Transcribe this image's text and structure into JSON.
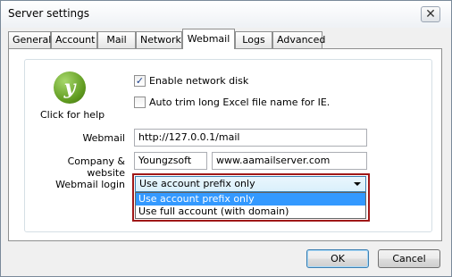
{
  "window": {
    "title": "Server settings",
    "close_glyph": "✕"
  },
  "tabs": [
    {
      "label": "General",
      "active": false
    },
    {
      "label": "Account",
      "active": false
    },
    {
      "label": "Mail",
      "active": false
    },
    {
      "label": "Network",
      "active": false
    },
    {
      "label": "Webmail",
      "active": true
    },
    {
      "label": "Logs",
      "active": false
    },
    {
      "label": "Advanced",
      "active": false
    }
  ],
  "help": {
    "icon": "youngzsoft-logo-icon",
    "glyph": "y",
    "label": "Click for help"
  },
  "options": {
    "enable_network_disk": {
      "label": "Enable network disk",
      "checked": true
    },
    "auto_trim": {
      "label": "Auto trim long Excel file name for IE.",
      "checked": false
    }
  },
  "fields": {
    "webmail": {
      "label": "Webmail",
      "value": "http://127.0.0.1/mail"
    },
    "company_website": {
      "label": "Company & website",
      "company": "Youngzsoft",
      "website": "www.aamailserver.com"
    },
    "webmail_login": {
      "label": "Webmail login",
      "selected": "Use account prefix only",
      "dropdown_options": [
        "Use account prefix only",
        "Use full account (with domain)"
      ]
    }
  },
  "buttons": {
    "ok": "OK",
    "cancel": "Cancel"
  },
  "colors": {
    "highlight_border": "#a01818",
    "selected_option": "#3399ff"
  }
}
